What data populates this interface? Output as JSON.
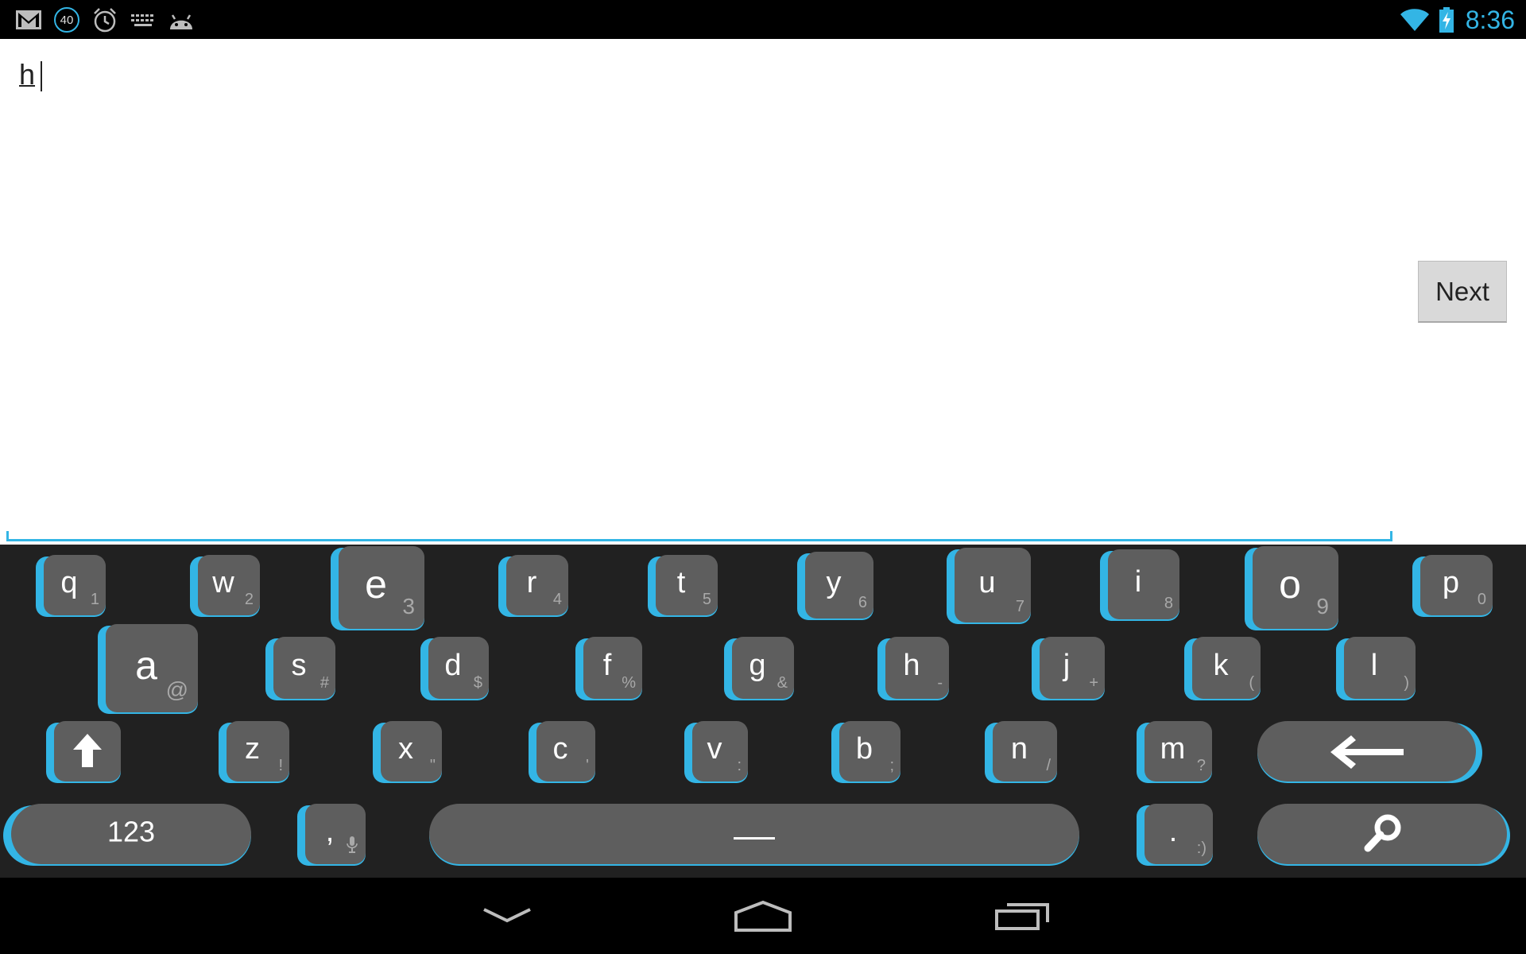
{
  "status_bar": {
    "icons": [
      "gmail-icon",
      "notification-count-icon",
      "alarm-icon",
      "keyboard-icon",
      "android-icon"
    ],
    "notification_count": "40",
    "right_icons": [
      "wifi-icon",
      "battery-charging-icon"
    ],
    "time": "8:36"
  },
  "editor": {
    "typed_text": "h"
  },
  "next_button": {
    "label": "Next"
  },
  "keyboard": {
    "accent_color": "#33b5e5",
    "row1": [
      {
        "main": "q",
        "sub": "1"
      },
      {
        "main": "w",
        "sub": "2"
      },
      {
        "main": "e",
        "sub": "3"
      },
      {
        "main": "r",
        "sub": "4"
      },
      {
        "main": "t",
        "sub": "5"
      },
      {
        "main": "y",
        "sub": "6"
      },
      {
        "main": "u",
        "sub": "7"
      },
      {
        "main": "i",
        "sub": "8"
      },
      {
        "main": "o",
        "sub": "9"
      },
      {
        "main": "p",
        "sub": "0"
      }
    ],
    "row2": [
      {
        "main": "a",
        "sub": "@"
      },
      {
        "main": "s",
        "sub": "#"
      },
      {
        "main": "d",
        "sub": "$"
      },
      {
        "main": "f",
        "sub": "%"
      },
      {
        "main": "g",
        "sub": "&"
      },
      {
        "main": "h",
        "sub": "-"
      },
      {
        "main": "j",
        "sub": "+"
      },
      {
        "main": "k",
        "sub": "("
      },
      {
        "main": "l",
        "sub": ")"
      }
    ],
    "row3": [
      {
        "main": "z",
        "sub": "!"
      },
      {
        "main": "x",
        "sub": "\""
      },
      {
        "main": "c",
        "sub": "'"
      },
      {
        "main": "v",
        "sub": ":"
      },
      {
        "main": "b",
        "sub": ";"
      },
      {
        "main": "n",
        "sub": "/"
      },
      {
        "main": "m",
        "sub": "?"
      }
    ],
    "row4": {
      "symbols_label": "123",
      "comma": ",",
      "space_label": "__",
      "period": ".",
      "period_sub": ":)"
    }
  }
}
